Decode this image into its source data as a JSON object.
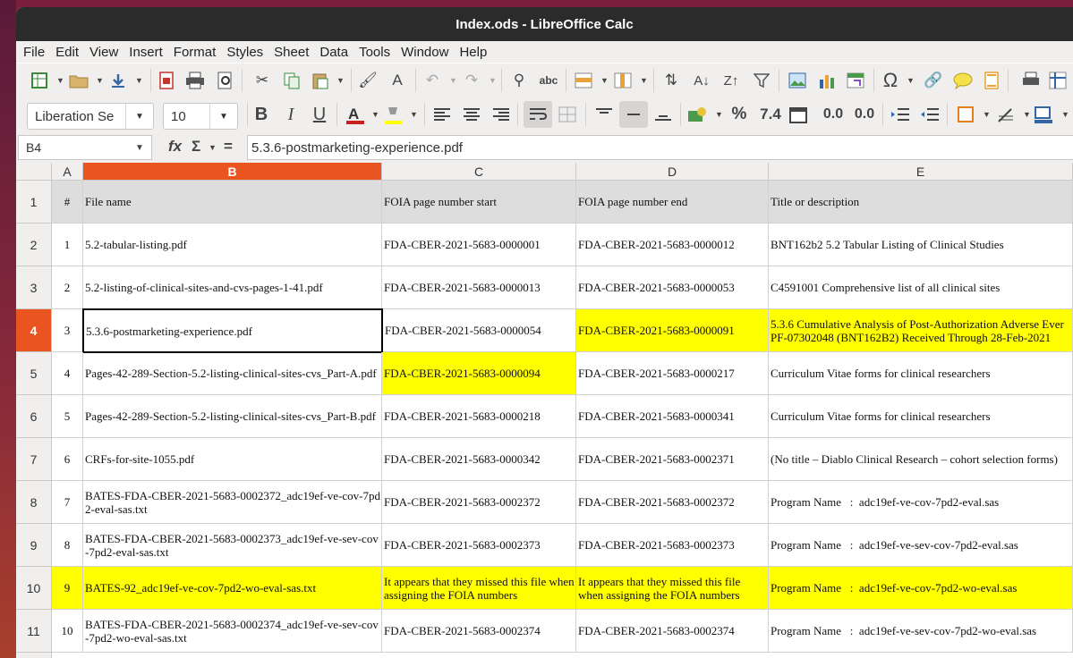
{
  "window": {
    "title": "Index.ods - LibreOffice Calc"
  },
  "menu": [
    "File",
    "Edit",
    "View",
    "Insert",
    "Format",
    "Styles",
    "Sheet",
    "Data",
    "Tools",
    "Window",
    "Help"
  ],
  "toolbar": {
    "font_name": "Liberation Se",
    "font_size": "10",
    "bold_label": "B",
    "italic_label": "I",
    "underline_label": "U",
    "percent_label": "%",
    "number_label": "7.4",
    "add_decimal_label": "0.0",
    "del_decimal_label": "0.0"
  },
  "formula_bar": {
    "cell_ref": "B4",
    "fx_label": "fx",
    "sum_label": "Σ",
    "eq_label": "=",
    "content": "5.3.6-postmarketing-experience.pdf"
  },
  "columns": [
    "A",
    "B",
    "C",
    "D",
    "E"
  ],
  "selected_column": "B",
  "selected_row": "4",
  "rows": [
    {
      "num": "1",
      "cells": [
        "#",
        "File name",
        "FOIA page number start",
        "FOIA page number end",
        "Title or description"
      ]
    },
    {
      "num": "2",
      "cells": [
        "1",
        "5.2-tabular-listing.pdf",
        "FDA-CBER-2021-5683-0000001",
        "FDA-CBER-2021-5683-0000012",
        "BNT162b2 5.2 Tabular Listing of Clinical Studies"
      ]
    },
    {
      "num": "3",
      "cells": [
        "2",
        "5.2-listing-of-clinical-sites-and-cvs-pages-1-41.pdf",
        "FDA-CBER-2021-5683-0000013",
        "FDA-CBER-2021-5683-0000053",
        "C4591001 Comprehensive list of all clinical sites"
      ]
    },
    {
      "num": "4",
      "cells": [
        "3",
        "5.3.6-postmarketing-experience.pdf",
        "FDA-CBER-2021-5683-0000054",
        "FDA-CBER-2021-5683-0000091",
        "5.3.6 Cumulative Analysis of Post-Authorization Adverse Ever PF-07302048 (BNT162B2) Received Through 28-Feb-2021"
      ]
    },
    {
      "num": "5",
      "cells": [
        "4",
        "Pages-42-289-Section-5.2-listing-clinical-sites-cvs_Part-A.pdf",
        "FDA-CBER-2021-5683-0000094",
        "FDA-CBER-2021-5683-0000217",
        "Curriculum Vitae forms for clinical researchers"
      ]
    },
    {
      "num": "6",
      "cells": [
        "5",
        "Pages-42-289-Section-5.2-listing-clinical-sites-cvs_Part-B.pdf",
        "FDA-CBER-2021-5683-0000218",
        "FDA-CBER-2021-5683-0000341",
        "Curriculum Vitae forms for clinical researchers"
      ]
    },
    {
      "num": "7",
      "cells": [
        "6",
        "CRFs-for-site-1055.pdf",
        "FDA-CBER-2021-5683-0000342",
        "FDA-CBER-2021-5683-0002371",
        "(No title – Diablo Clinical Research – cohort selection forms)"
      ]
    },
    {
      "num": "8",
      "cells": [
        "7",
        "BATES-FDA-CBER-2021-5683-0002372_adc19ef-ve-cov-7pd2-eval-sas.txt",
        "FDA-CBER-2021-5683-0002372",
        "FDA-CBER-2021-5683-0002372",
        "Program Name   :  adc19ef-ve-cov-7pd2-eval.sas"
      ]
    },
    {
      "num": "9",
      "cells": [
        "8",
        "BATES-FDA-CBER-2021-5683-0002373_adc19ef-ve-sev-cov-7pd2-eval-sas.txt",
        "FDA-CBER-2021-5683-0002373",
        "FDA-CBER-2021-5683-0002373",
        "Program Name   :  adc19ef-ve-sev-cov-7pd2-eval.sas"
      ]
    },
    {
      "num": "10",
      "cells": [
        "9",
        "BATES-92_adc19ef-ve-cov-7pd2-wo-eval-sas.txt",
        "It appears that they missed this file when assigning the FOIA numbers",
        "It appears that they missed this file when assigning the FOIA numbers",
        "Program Name   :  adc19ef-ve-cov-7pd2-wo-eval.sas"
      ]
    },
    {
      "num": "11",
      "cells": [
        "10",
        "BATES-FDA-CBER-2021-5683-0002374_adc19ef-ve-sev-cov-7pd2-wo-eval-sas.txt",
        "FDA-CBER-2021-5683-0002374",
        "FDA-CBER-2021-5683-0002374",
        "Program Name   :  adc19ef-ve-sev-cov-7pd2-wo-eval.sas"
      ]
    }
  ],
  "colors": {
    "highlight": "#ffff00",
    "selection": "#e95420",
    "header_fill": "#dddddd"
  }
}
